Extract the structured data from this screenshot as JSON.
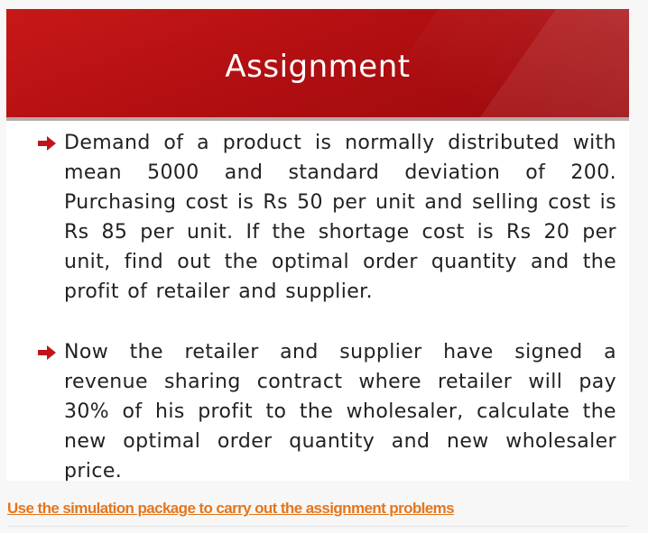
{
  "slide": {
    "title": "Assignment",
    "accent_color": "#b30f12",
    "bullet_icon": "arrow-right-icon",
    "bullets": [
      {
        "text": "Demand of a product is normally distributed with mean 5000 and standard deviation of 200. Purchasing cost is Rs 50 per unit and selling cost is Rs 85 per unit. If the shortage cost is Rs 20 per unit, find out the optimal order quantity and the profit of retailer and supplier."
      },
      {
        "text": "Now the retailer and supplier have signed a revenue sharing contract where retailer will pay 30% of his profit to the wholesaler, calculate the new optimal order quantity and new wholesaler price."
      }
    ]
  },
  "footer": {
    "link_text": "Use the simulation package to carry out the assignment problems",
    "link_color": "#e4761e"
  }
}
